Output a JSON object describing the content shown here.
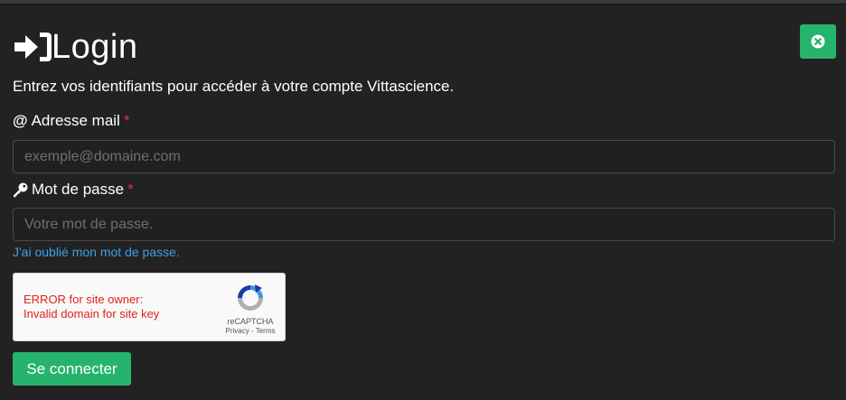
{
  "modal": {
    "title": "Login",
    "intro": "Entrez vos identifiants pour accéder à votre compte Vittascience.",
    "close_icon": "close-circle-icon",
    "header_icon": "sign-in-icon",
    "accent_color": "#26b36e"
  },
  "form": {
    "email": {
      "icon": "@",
      "label": "Adresse mail",
      "required_mark": "*",
      "placeholder": "exemple@domaine.com",
      "value": ""
    },
    "password": {
      "icon": "key-icon",
      "label": "Mot de passe",
      "required_mark": "*",
      "placeholder": "Votre mot de passe.",
      "value": ""
    },
    "forgot_link": "J'ai oublié mon mot de passe.",
    "recaptcha": {
      "error_line1": "ERROR for site owner:",
      "error_line2": "Invalid domain for site key",
      "brand": "reCAPTCHA",
      "terms": "Privacy - Terms"
    },
    "submit_label": "Se connecter"
  }
}
